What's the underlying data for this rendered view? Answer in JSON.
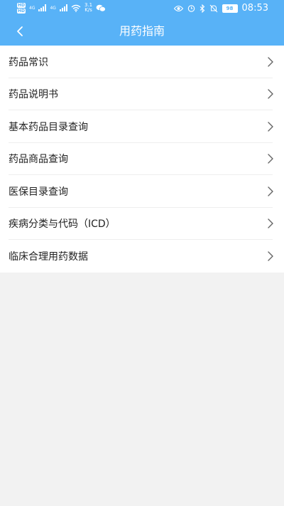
{
  "status_bar": {
    "hd_badge_top": "HD",
    "hd_badge_bottom": "HD",
    "net_4g_a": "4G",
    "net_4g_b": "4G",
    "speed_value": "3.1",
    "speed_unit": "K/s",
    "battery": "98",
    "time": "08:53",
    "icons": [
      "eye-icon",
      "alarm-icon",
      "bluetooth-icon",
      "mute-icon",
      "wifi-icon",
      "wechat-icon"
    ]
  },
  "header": {
    "title": "用药指南",
    "back_icon": "chevron-left-icon",
    "background": "#58b2f7"
  },
  "menu": {
    "items": [
      {
        "label": "药品常识"
      },
      {
        "label": "药品说明书"
      },
      {
        "label": "基本药品目录查询"
      },
      {
        "label": "药品商品查询"
      },
      {
        "label": "医保目录查询"
      },
      {
        "label": "疾病分类与代码（ICD）"
      },
      {
        "label": "临床合理用药数据"
      }
    ],
    "chevron_icon": "chevron-right-icon"
  },
  "colors": {
    "accent": "#58b2f7",
    "page_background": "#f2f2f2",
    "text": "#222222"
  }
}
